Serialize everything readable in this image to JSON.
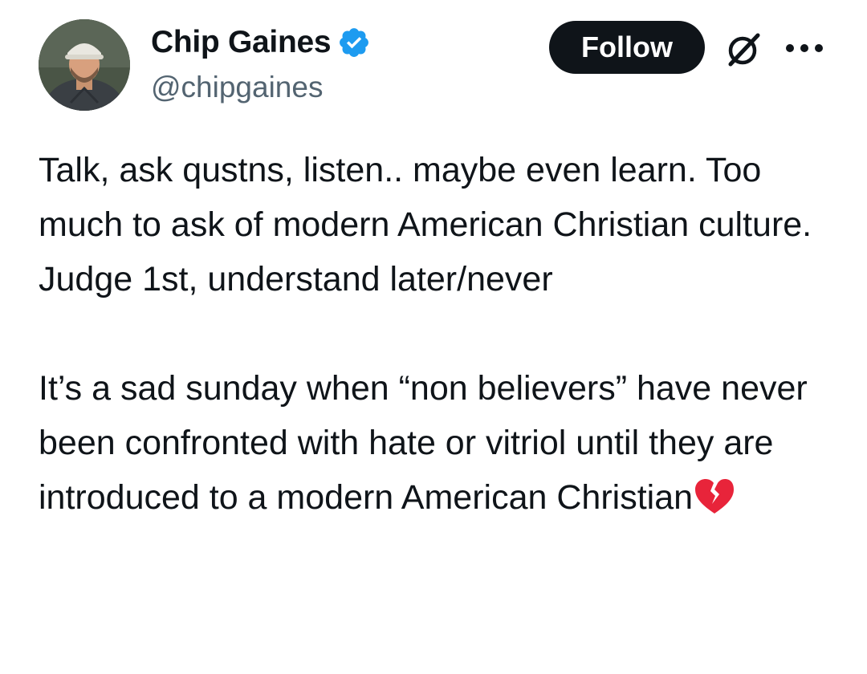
{
  "author": {
    "display_name": "Chip Gaines",
    "handle": "@chipgaines",
    "verified": true,
    "avatar_icon": "profile-photo"
  },
  "actions": {
    "follow_label": "Follow",
    "grok_icon": "grok-icon",
    "more_icon": "more-horizontal-icon"
  },
  "tweet": {
    "paragraph_1": "Talk, ask qustns, listen.. maybe even learn. Too much to ask of modern American Christian culture. Judge 1st, understand later/never",
    "paragraph_2": "It’s a sad sunday when “non believers” have never been confronted with hate or vitriol until they are introduced to a modern American Christian",
    "trailing_emoji": "broken-heart-icon"
  },
  "colors": {
    "text_primary": "#0f1419",
    "text_secondary": "#536471",
    "follow_bg": "#0f1419",
    "verified_blue": "#1d9bf0",
    "broken_heart_red": "#e8243a"
  }
}
